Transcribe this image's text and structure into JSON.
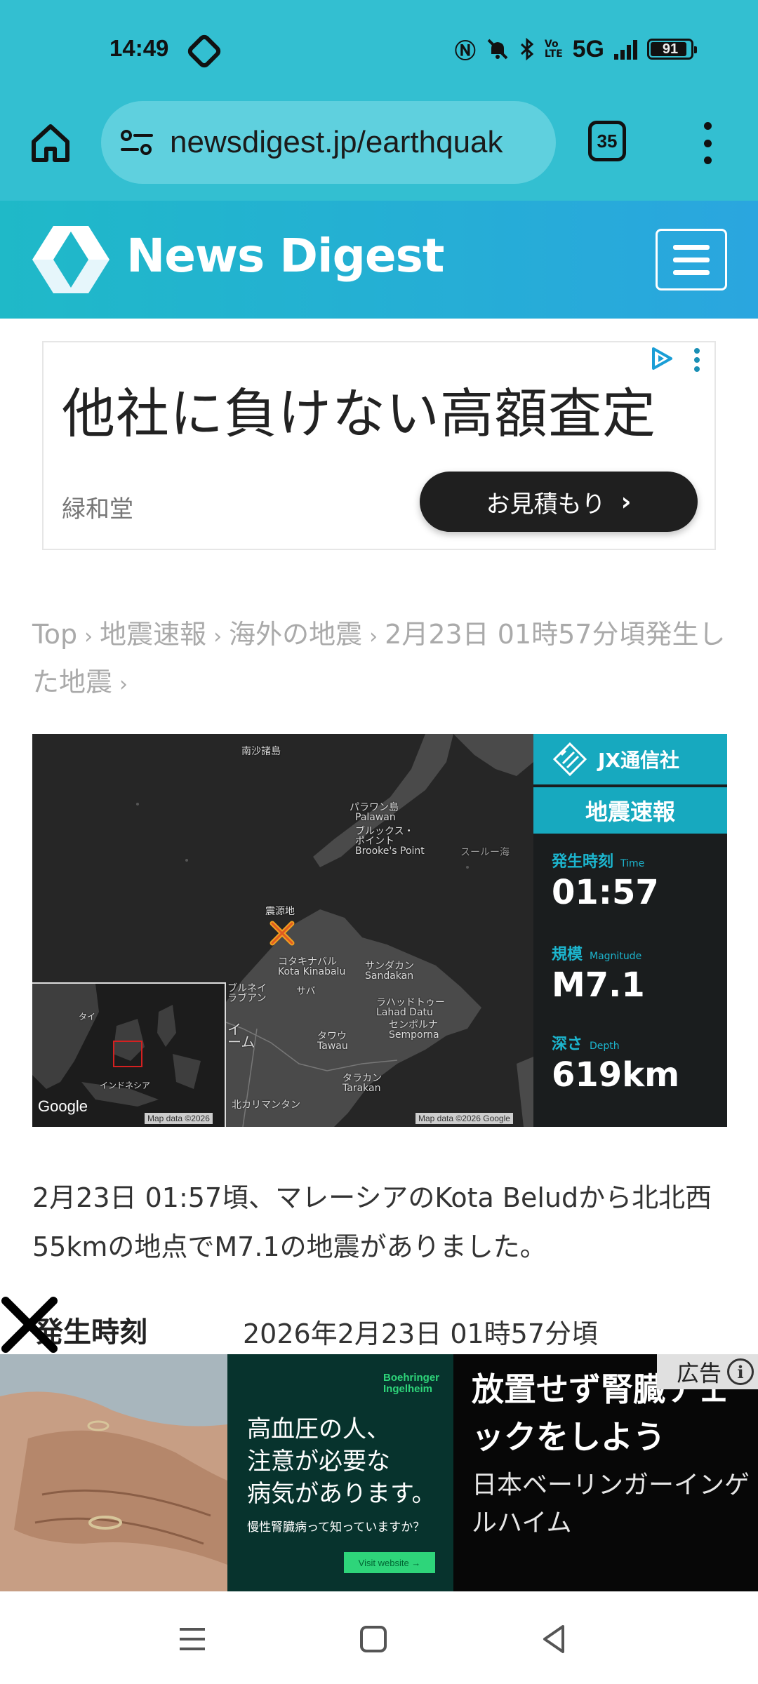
{
  "status_bar": {
    "time": "14:49",
    "network": "5G",
    "battery": "91",
    "battery_level": 0.91
  },
  "browser": {
    "url": "newsdigest.jp/earthquak",
    "tab_count": "35"
  },
  "site": {
    "name": "News Digest"
  },
  "top_ad": {
    "headline": "他社に負けない高額査定",
    "brand": "緑和堂",
    "cta": "お見積もり"
  },
  "breadcrumb": {
    "items": [
      "Top",
      "地震速報",
      "海外の地震",
      "2月23日 01時57分頃発生した地震"
    ]
  },
  "quake_card": {
    "map_labels": {
      "spratly": "南沙諸島",
      "palawan_jp": "パラワン島",
      "palawan_en": "Palawan",
      "brookes_jp1": "ブルックス・",
      "brookes_jp2": "ポイント",
      "brookes_en": "Brooke's Point",
      "sulu": "スールー海",
      "epicenter": "震源地",
      "kk_jp": "コタキナバル",
      "kk_en": "Kota Kinabalu",
      "sandakan_jp": "サンダカン",
      "sandakan_en": "Sandakan",
      "sabah": "サバ",
      "lahad_jp": "ラハッドトゥー",
      "lahad_en": "Lahad Datu",
      "semporna_jp": "センポルナ",
      "semporna_en": "Semporna",
      "tawau_jp": "タワウ",
      "tawau_en": "Tawau",
      "tarakan_jp": "タラカン",
      "tarakan_en": "Tarakan",
      "kalimantan": "北カリマンタン",
      "brunei1": "ブルネイ",
      "brunei2": "ラブアン",
      "sarawak": "イ",
      "sarawak2": "ーム",
      "inset_thai": "タイ",
      "inset_indonesia": "インドネシア",
      "google": "Google",
      "mapdata_inset": "Map data ©2026",
      "mapdata_main": "Map data ©2026 Google"
    },
    "agency": "JX通信社",
    "panel_title": "地震速報",
    "time_label": "発生時刻",
    "time_label_en": "Time",
    "time_value": "01:57",
    "mag_label": "規模",
    "mag_label_en": "Magnitude",
    "mag_value": "M7.1",
    "depth_label": "深さ",
    "depth_label_en": "Depth",
    "depth_value": "619km"
  },
  "summary": "2月23日 01:57頃、マレーシアのKota Beludから北北西55kmの地点でM7.1の地震がありました。",
  "info": {
    "key": "発生時刻",
    "value": "2026年2月23日 01時57分頃"
  },
  "bottom_ad": {
    "sponsor_line1": "Boehringer",
    "sponsor_line2": "Ingelheim",
    "body": "高血圧の人、注意が必要な病気があります。",
    "body_line1": "高血圧の人、",
    "body_line2": "注意が必要な",
    "body_line3": "病気があります。",
    "small": "慢性腎臓病って知っていますか？",
    "button": "Visit website →",
    "headline": "放置せず腎臓チェックをしよう",
    "advertiser": "日本ベーリンガーインゲルハイム",
    "tag": "広告"
  }
}
